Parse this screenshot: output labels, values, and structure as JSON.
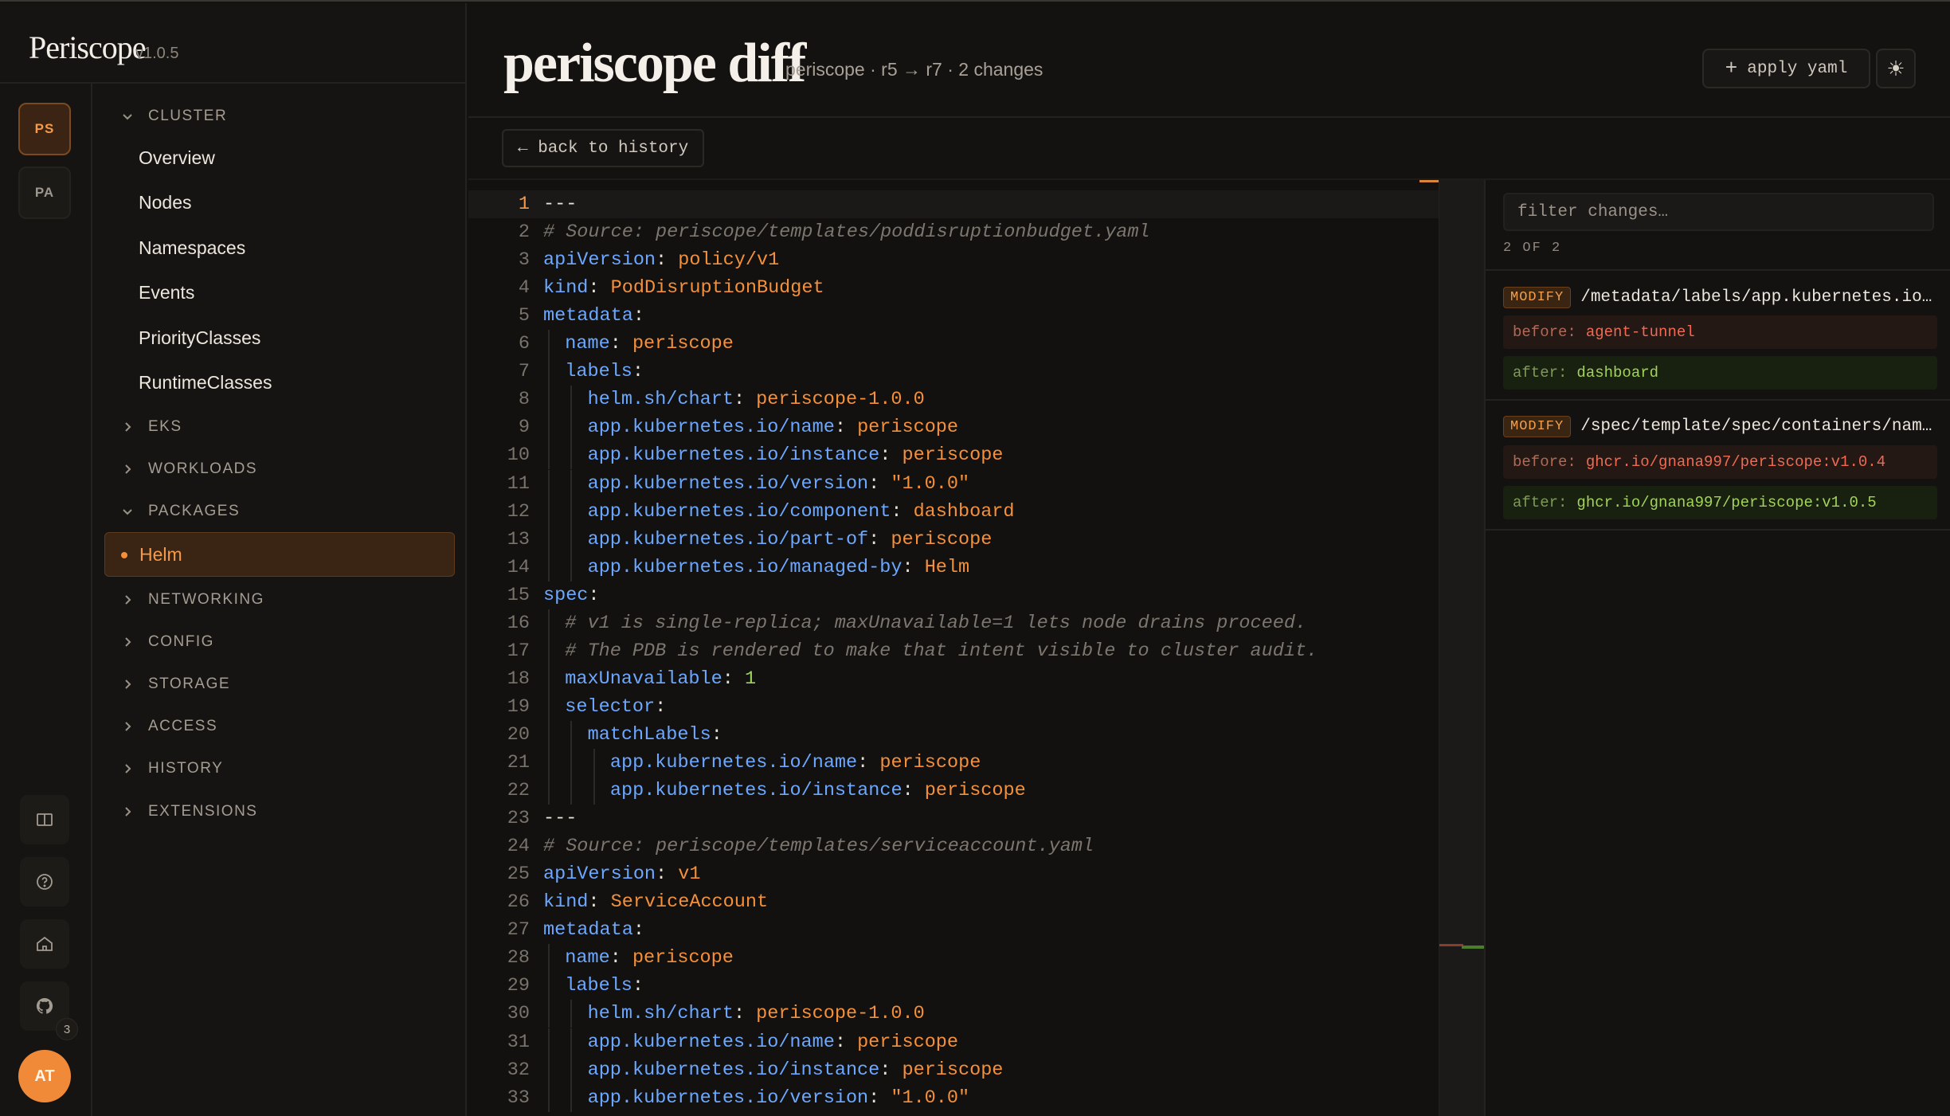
{
  "brand": {
    "name": "Periscope",
    "version": "v1.0.5"
  },
  "workspaces": [
    "PS",
    "PA"
  ],
  "rail": {
    "github_count": "3",
    "avatar": "AT"
  },
  "nav": {
    "cluster": "CLUSTER",
    "cluster_items": [
      "Overview",
      "Nodes",
      "Namespaces",
      "Events",
      "PriorityClasses",
      "RuntimeClasses"
    ],
    "eks": "EKS",
    "workloads": "WORKLOADS",
    "packages": "PACKAGES",
    "active_item": "Helm",
    "networking": "NETWORKING",
    "config": "CONFIG",
    "storage": "STORAGE",
    "access": "ACCESS",
    "history": "HISTORY",
    "extensions": "EXTENSIONS"
  },
  "header": {
    "title": "periscope diff",
    "subtitle": "periscope · r5 → r7 · 2 changes",
    "apply_label": "apply yaml",
    "back_label": "← back to history"
  },
  "editor": {
    "lines": [
      {
        "n": "1",
        "tokens": [
          [
            "p",
            "---"
          ]
        ]
      },
      {
        "n": "2",
        "tokens": [
          [
            "c",
            "# Source: periscope/templates/poddisruptionbudget.yaml"
          ]
        ]
      },
      {
        "n": "3",
        "tokens": [
          [
            "k",
            "apiVersion"
          ],
          [
            "p",
            ": "
          ],
          [
            "v",
            "policy/v1"
          ]
        ]
      },
      {
        "n": "4",
        "tokens": [
          [
            "k",
            "kind"
          ],
          [
            "p",
            ": "
          ],
          [
            "v",
            "PodDisruptionBudget"
          ]
        ]
      },
      {
        "n": "5",
        "tokens": [
          [
            "k",
            "metadata"
          ],
          [
            "p",
            ":"
          ]
        ]
      },
      {
        "n": "6",
        "indent": 1,
        "tokens": [
          [
            "k",
            "name"
          ],
          [
            "p",
            ": "
          ],
          [
            "v",
            "periscope"
          ]
        ]
      },
      {
        "n": "7",
        "indent": 1,
        "tokens": [
          [
            "k",
            "labels"
          ],
          [
            "p",
            ":"
          ]
        ]
      },
      {
        "n": "8",
        "indent": 2,
        "tokens": [
          [
            "k",
            "helm.sh/chart"
          ],
          [
            "p",
            ": "
          ],
          [
            "v",
            "periscope-1.0.0"
          ]
        ]
      },
      {
        "n": "9",
        "indent": 2,
        "tokens": [
          [
            "k",
            "app.kubernetes.io/name"
          ],
          [
            "p",
            ": "
          ],
          [
            "v",
            "periscope"
          ]
        ]
      },
      {
        "n": "10",
        "indent": 2,
        "tokens": [
          [
            "k",
            "app.kubernetes.io/instance"
          ],
          [
            "p",
            ": "
          ],
          [
            "v",
            "periscope"
          ]
        ]
      },
      {
        "n": "11",
        "indent": 2,
        "tokens": [
          [
            "k",
            "app.kubernetes.io/version"
          ],
          [
            "p",
            ": "
          ],
          [
            "v",
            "\"1.0.0\""
          ]
        ]
      },
      {
        "n": "12",
        "indent": 2,
        "tokens": [
          [
            "k",
            "app.kubernetes.io/component"
          ],
          [
            "p",
            ": "
          ],
          [
            "v",
            "dashboard"
          ]
        ]
      },
      {
        "n": "13",
        "indent": 2,
        "tokens": [
          [
            "k",
            "app.kubernetes.io/part-of"
          ],
          [
            "p",
            ": "
          ],
          [
            "v",
            "periscope"
          ]
        ]
      },
      {
        "n": "14",
        "indent": 2,
        "tokens": [
          [
            "k",
            "app.kubernetes.io/managed-by"
          ],
          [
            "p",
            ": "
          ],
          [
            "v",
            "Helm"
          ]
        ]
      },
      {
        "n": "15",
        "tokens": [
          [
            "k",
            "spec"
          ],
          [
            "p",
            ":"
          ]
        ]
      },
      {
        "n": "16",
        "indent": 1,
        "tokens": [
          [
            "c",
            "# v1 is single-replica; maxUnavailable=1 lets node drains proceed."
          ]
        ]
      },
      {
        "n": "17",
        "indent": 1,
        "tokens": [
          [
            "c",
            "# The PDB is rendered to make that intent visible to cluster audit."
          ]
        ]
      },
      {
        "n": "18",
        "indent": 1,
        "tokens": [
          [
            "k",
            "maxUnavailable"
          ],
          [
            "p",
            ": "
          ],
          [
            "n",
            "1"
          ]
        ]
      },
      {
        "n": "19",
        "indent": 1,
        "tokens": [
          [
            "k",
            "selector"
          ],
          [
            "p",
            ":"
          ]
        ]
      },
      {
        "n": "20",
        "indent": 2,
        "tokens": [
          [
            "k",
            "matchLabels"
          ],
          [
            "p",
            ":"
          ]
        ]
      },
      {
        "n": "21",
        "indent": 3,
        "tokens": [
          [
            "k",
            "app.kubernetes.io/name"
          ],
          [
            "p",
            ": "
          ],
          [
            "v",
            "periscope"
          ]
        ]
      },
      {
        "n": "22",
        "indent": 3,
        "tokens": [
          [
            "k",
            "app.kubernetes.io/instance"
          ],
          [
            "p",
            ": "
          ],
          [
            "v",
            "periscope"
          ]
        ]
      },
      {
        "n": "23",
        "tokens": [
          [
            "p",
            "---"
          ]
        ]
      },
      {
        "n": "24",
        "tokens": [
          [
            "c",
            "# Source: periscope/templates/serviceaccount.yaml"
          ]
        ]
      },
      {
        "n": "25",
        "tokens": [
          [
            "k",
            "apiVersion"
          ],
          [
            "p",
            ": "
          ],
          [
            "v",
            "v1"
          ]
        ]
      },
      {
        "n": "26",
        "tokens": [
          [
            "k",
            "kind"
          ],
          [
            "p",
            ": "
          ],
          [
            "v",
            "ServiceAccount"
          ]
        ]
      },
      {
        "n": "27",
        "tokens": [
          [
            "k",
            "metadata"
          ],
          [
            "p",
            ":"
          ]
        ]
      },
      {
        "n": "28",
        "indent": 1,
        "tokens": [
          [
            "k",
            "name"
          ],
          [
            "p",
            ": "
          ],
          [
            "v",
            "periscope"
          ]
        ]
      },
      {
        "n": "29",
        "indent": 1,
        "tokens": [
          [
            "k",
            "labels"
          ],
          [
            "p",
            ":"
          ]
        ]
      },
      {
        "n": "30",
        "indent": 2,
        "tokens": [
          [
            "k",
            "helm.sh/chart"
          ],
          [
            "p",
            ": "
          ],
          [
            "v",
            "periscope-1.0.0"
          ]
        ]
      },
      {
        "n": "31",
        "indent": 2,
        "tokens": [
          [
            "k",
            "app.kubernetes.io/name"
          ],
          [
            "p",
            ": "
          ],
          [
            "v",
            "periscope"
          ]
        ]
      },
      {
        "n": "32",
        "indent": 2,
        "tokens": [
          [
            "k",
            "app.kubernetes.io/instance"
          ],
          [
            "p",
            ": "
          ],
          [
            "v",
            "periscope"
          ]
        ]
      },
      {
        "n": "33",
        "indent": 2,
        "tokens": [
          [
            "k",
            "app.kubernetes.io/version"
          ],
          [
            "p",
            ": "
          ],
          [
            "v",
            "\"1.0.0\""
          ]
        ]
      }
    ]
  },
  "changes": {
    "filter_placeholder": "filter changes…",
    "count": "2 OF 2",
    "items": [
      {
        "op": "MODIFY",
        "path": "/metadata/labels/app.kubernetes.io/component",
        "before_label": "before:",
        "before": "agent-tunnel",
        "after_label": "after:",
        "after": "dashboard"
      },
      {
        "op": "MODIFY",
        "path": "/spec/template/spec/containers/name=periscope/image",
        "before_label": "before:",
        "before": "ghcr.io/gnana997/periscope:v1.0.4",
        "after_label": "after:",
        "after": "ghcr.io/gnana997/periscope:v1.0.5"
      }
    ]
  },
  "colors": {
    "accent": "#f5903a",
    "yaml_key": "#6ca8ff",
    "yaml_value": "#f5903a",
    "yaml_number": "#9ed35a",
    "before": "#f06a52",
    "after": "#a2d35a"
  },
  "icons": [
    "chevron-down-icon",
    "chevron-right-icon",
    "book-icon",
    "help-icon",
    "home-icon",
    "github-icon",
    "plus-icon",
    "sun-icon",
    "back-arrow-icon"
  ]
}
